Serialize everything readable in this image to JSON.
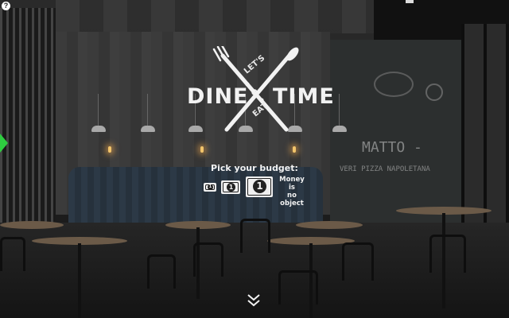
{
  "logo": {
    "lets": "LET'S",
    "dine": "DINE",
    "time": "TIME",
    "eat": "EAT"
  },
  "budget": {
    "title": "Pick your budget:",
    "options": [
      {
        "label": "1"
      },
      {
        "label": "1"
      },
      {
        "label": "1"
      }
    ],
    "no_limit_lines": [
      "Money",
      "is",
      "no",
      "object"
    ]
  },
  "controls": {
    "help": "?"
  },
  "chalkboard": {
    "text_1": "MATTO -",
    "text_2": "VERI PIZZA NAPOLETANA"
  },
  "colors": {
    "accent_tab": "#2ecc40",
    "logo_text": "#f2f2f2"
  },
  "icons": [
    "help-icon",
    "side-menu-tab-icon",
    "scroll-down-chevron-icon",
    "fork-icon",
    "knife-icon"
  ]
}
